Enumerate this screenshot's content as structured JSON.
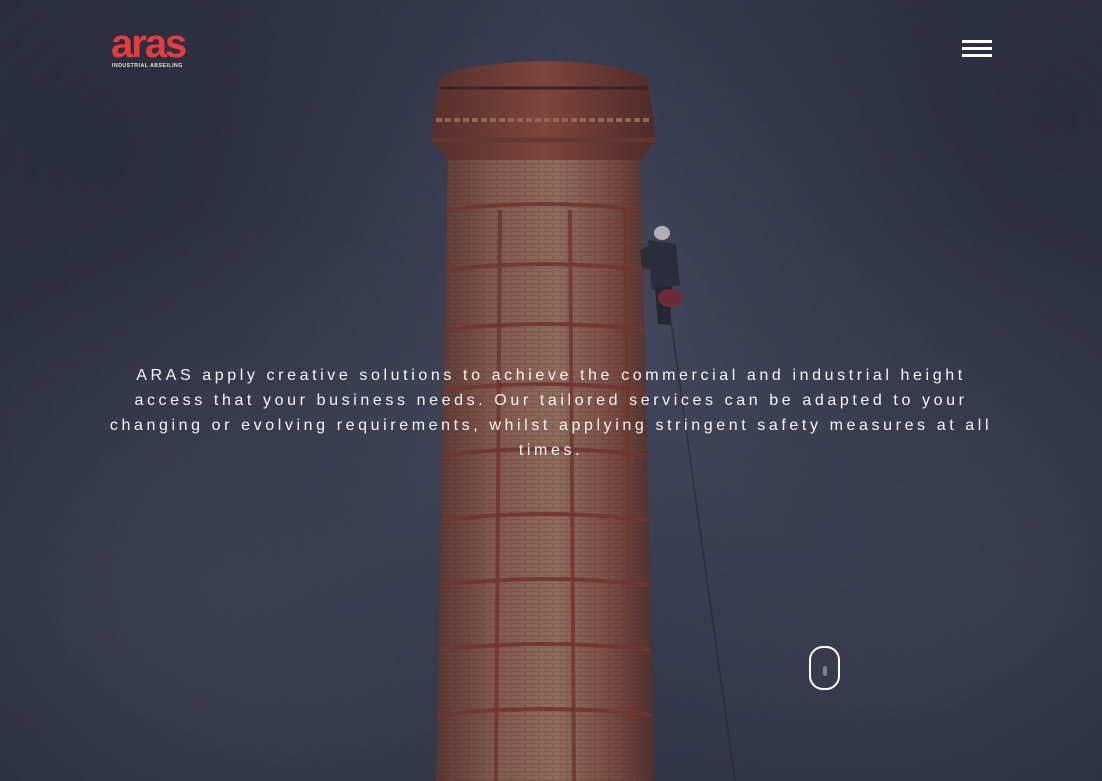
{
  "brand": {
    "name": "aras",
    "tagline": "INDUSTRIAL ABSEILING",
    "color": "#e63c40"
  },
  "header": {
    "menu_icon": "hamburger-menu-icon"
  },
  "hero": {
    "background": "brick-chimney-with-abseiler-photo",
    "intro_text": "ARAS apply creative solutions to achieve the commercial and industrial height access that your business needs. Our tailored services can be adapted to your changing or evolving requirements, whilst applying stringent safety measures at all times.",
    "scroll_icon": "mouse-scroll-icon"
  },
  "colors": {
    "overlay": "#3a3d55",
    "text": "#ffffff",
    "brick": "#a0543f"
  }
}
